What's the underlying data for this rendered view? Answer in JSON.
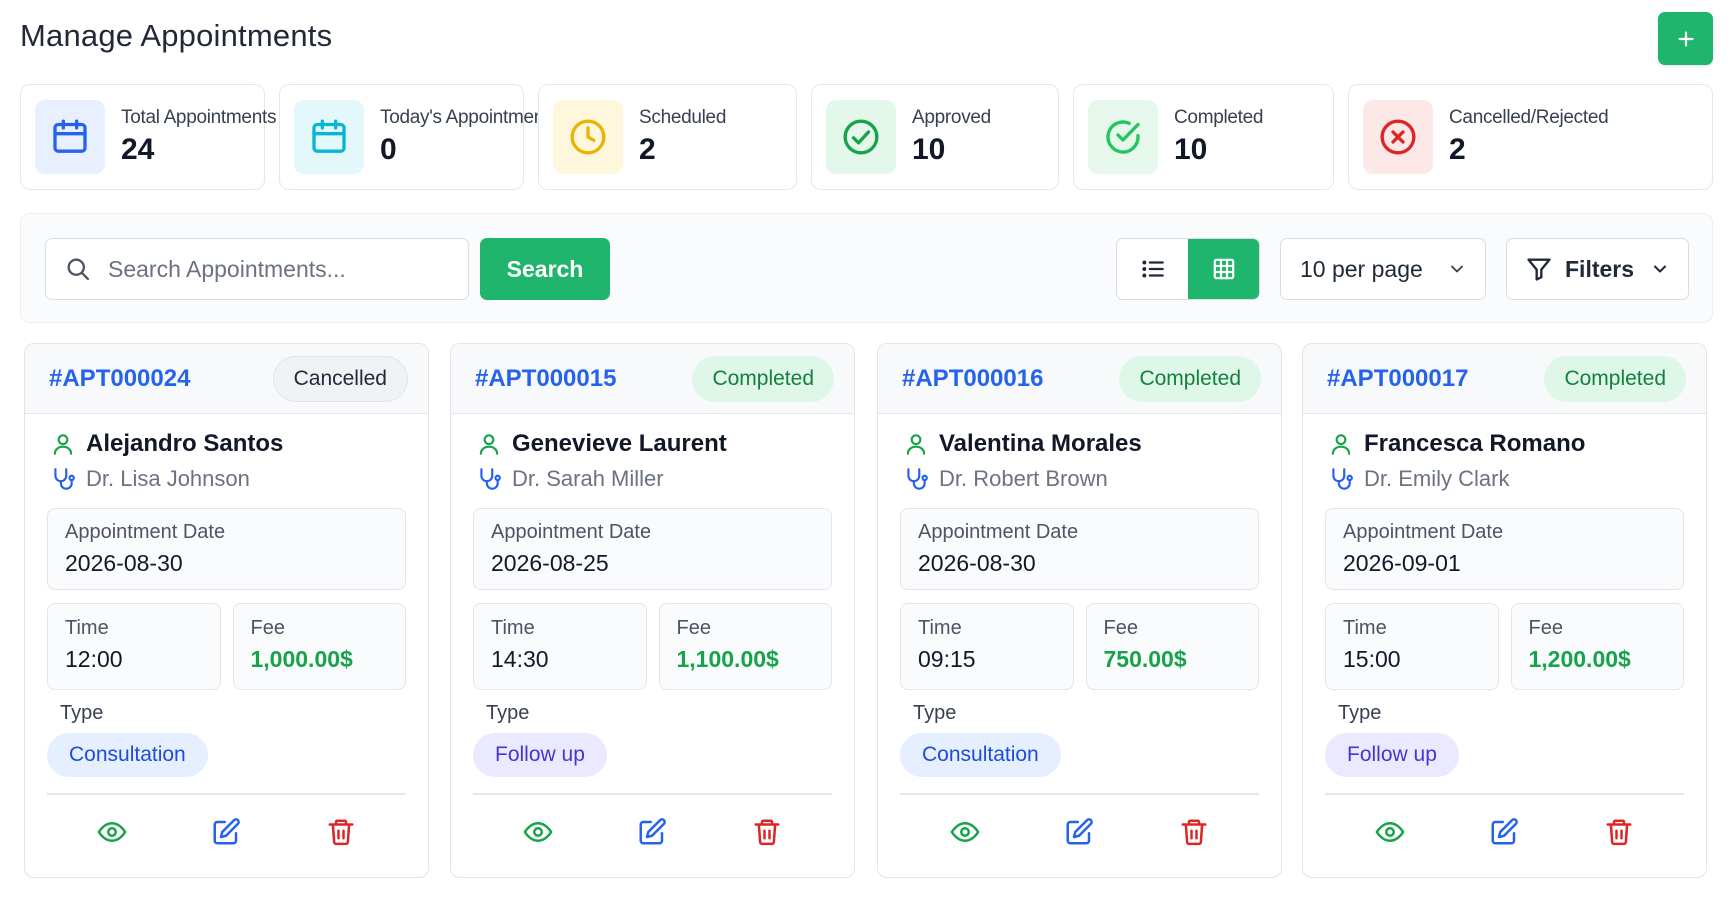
{
  "page": {
    "title": "Manage Appointments"
  },
  "header": {
    "add_icon": "plus-icon"
  },
  "stats": [
    {
      "label": "Total Appointments",
      "value": "24",
      "icon": "calendar-icon",
      "color": "#2563eb",
      "bg": "#e8efff"
    },
    {
      "label": "Today's Appointments",
      "value": "0",
      "icon": "calendar-icon",
      "color": "#06b6d4",
      "bg": "#e3f8fb"
    },
    {
      "label": "Scheduled",
      "value": "2",
      "icon": "clock-icon",
      "color": "#eab308",
      "bg": "#fff7dc"
    },
    {
      "label": "Approved",
      "value": "10",
      "icon": "check-circle-icon",
      "color": "#16a34a",
      "bg": "#e3f7ea"
    },
    {
      "label": "Completed",
      "value": "10",
      "icon": "check-circle-icon",
      "color": "#22c55e",
      "bg": "#e6f8ec"
    },
    {
      "label": "Cancelled/Rejected",
      "value": "2",
      "icon": "x-circle-icon",
      "color": "#dc2626",
      "bg": "#fde8e8"
    }
  ],
  "toolbar": {
    "search_placeholder": "Search Appointments...",
    "search_button": "Search",
    "per_page": "10 per page",
    "filters": "Filters"
  },
  "colors": {
    "primary": "#20b56c",
    "link": "#2563eb",
    "fee": "#16a34a"
  },
  "appointments": [
    {
      "id": "#APT000024",
      "status": "Cancelled",
      "patient": "Alejandro Santos",
      "doctor": "Dr. Lisa Johnson",
      "date_label": "Appointment Date",
      "date": "2026-08-30",
      "time_label": "Time",
      "time": "12:00",
      "fee_label": "Fee",
      "fee": "1,000.00$",
      "type_label": "Type",
      "type": "Consultation"
    },
    {
      "id": "#APT000015",
      "status": "Completed",
      "patient": "Genevieve Laurent",
      "doctor": "Dr. Sarah Miller",
      "date_label": "Appointment Date",
      "date": "2026-08-25",
      "time_label": "Time",
      "time": "14:30",
      "fee_label": "Fee",
      "fee": "1,100.00$",
      "type_label": "Type",
      "type": "Follow up"
    },
    {
      "id": "#APT000016",
      "status": "Completed",
      "patient": "Valentina Morales",
      "doctor": "Dr. Robert Brown",
      "date_label": "Appointment Date",
      "date": "2026-08-30",
      "time_label": "Time",
      "time": "09:15",
      "fee_label": "Fee",
      "fee": "750.00$",
      "type_label": "Type",
      "type": "Consultation"
    },
    {
      "id": "#APT000017",
      "status": "Completed",
      "patient": "Francesca Romano",
      "doctor": "Dr. Emily Clark",
      "date_label": "Appointment Date",
      "date": "2026-09-01",
      "time_label": "Time",
      "time": "15:00",
      "fee_label": "Fee",
      "fee": "1,200.00$",
      "type_label": "Type",
      "type": "Follow up"
    }
  ]
}
